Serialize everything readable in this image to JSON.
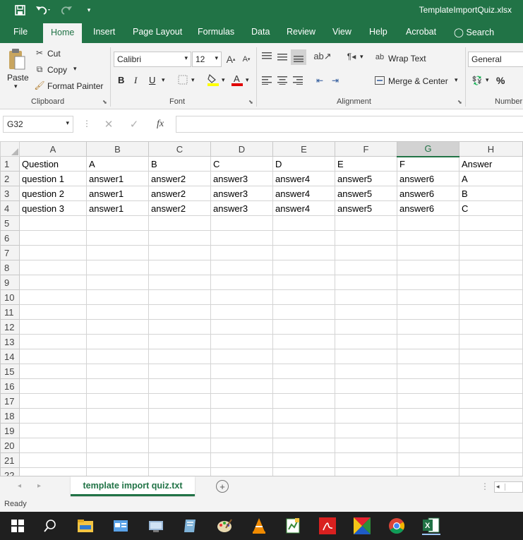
{
  "window": {
    "title": "TemplateImportQuiz.xlsx"
  },
  "tabs": [
    "File",
    "Home",
    "Insert",
    "Page Layout",
    "Formulas",
    "Data",
    "Review",
    "View",
    "Help",
    "Acrobat"
  ],
  "search_label": "Search",
  "clipboard": {
    "paste": "Paste",
    "cut": "Cut",
    "copy": "Copy",
    "format_painter": "Format Painter",
    "label": "Clipboard"
  },
  "font": {
    "name": "Calibri",
    "size": "12",
    "bold": "B",
    "italic": "I",
    "underline": "U",
    "label": "Font"
  },
  "alignment": {
    "wrap_text": "Wrap Text",
    "merge_center": "Merge & Center",
    "label": "Alignment"
  },
  "number": {
    "format": "General",
    "percent": "%",
    "label": "Number"
  },
  "formula_bar": {
    "name_box": "G32",
    "fx": "fx",
    "value": ""
  },
  "columns": [
    "A",
    "B",
    "C",
    "D",
    "E",
    "F",
    "G",
    "H"
  ],
  "selected_column": "G",
  "rows": [
    [
      "Question",
      "A",
      "B",
      "C",
      "D",
      "E",
      "F",
      "Answer"
    ],
    [
      "question 1",
      "answer1",
      "answer2",
      "answer3",
      "answer4",
      "answer5",
      "answer6",
      "A"
    ],
    [
      "question 2",
      "answer1",
      "answer2",
      "answer3",
      "answer4",
      "answer5",
      "answer6",
      "B"
    ],
    [
      "question 3",
      "answer1",
      "answer2",
      "answer3",
      "answer4",
      "answer5",
      "answer6",
      "C"
    ]
  ],
  "row_count": 22,
  "sheet_tab": "template import quiz.txt",
  "status": "Ready",
  "colors": {
    "accent": "#217346",
    "taskbar": "#1f1f1f"
  }
}
